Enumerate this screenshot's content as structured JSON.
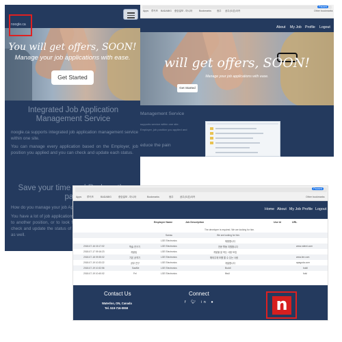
{
  "mobile": {
    "logo_text": "noogle.ca",
    "hero_title": "You will get offers, SOON!",
    "hero_sub": "Manage your job applications with ease.",
    "cta": "Get Started",
    "section1_title": "Integrated Job Application Management Service",
    "section1_p1": "noogle.ca supports integrated job application management service within one site.",
    "section1_p2": "You can manage every application based on the Employer, job position you applied and you can check and update each status.",
    "section2_title": "Save your time and Reduce the pain.",
    "section2_p1": "How do you manage your job Applications?",
    "section2_p2": "You have a lot of job applications to manage when you try to move to another position, or to look for a new job. It is very painful to check and update the status of each application and to follow up, as well."
  },
  "desktop": {
    "browser_profile": "Paused",
    "bookmarks": [
      "Apps",
      "루키즈",
      "BADABIG",
      "중앙일보 - 마니아",
      "Bookmarks",
      "광주",
      "공주(오픈)이카",
      "Other bookmarks"
    ],
    "nav": [
      "About",
      "My Job",
      "Profile",
      "Logout"
    ],
    "hero_title": "will get offers, SOON!",
    "hero_sub": "Manage your job applications with ease.",
    "cta": "Get Started",
    "section1_title": "Management Service",
    "section1_p1": "supports service within one site.",
    "section1_p2": "Employer, job position you applied and",
    "section2_title": "educe the pain"
  },
  "desktop2": {
    "browser_profile": "Paused",
    "bookmarks": [
      "Apps",
      "루키즈",
      "BADABIG",
      "중앙일보 - 마니아",
      "Bookmarks",
      "광주",
      "공주(오픈)이카",
      "Other bookmarks"
    ],
    "nav": [
      "Home",
      "About",
      "My Job",
      "Profile",
      "Logout"
    ],
    "table_headers": [
      "Employer Name",
      "Job Description",
      "Use Id",
      "URL"
    ],
    "table_rows": [
      [
        "",
        "",
        "",
        "The developer is required. We are looking for him.",
        "",
        ""
      ],
      [
        "",
        "",
        "Samsu",
        "We are looking for him.",
        "",
        ""
      ],
      [
        "",
        "",
        "LGE Electronics",
        "채용합니다",
        "",
        ""
      ],
      [
        "2018-07-16 15:17:02",
        "학술 연구기",
        "LGE Electronics",
        "전문 활동 지원합니다",
        "",
        "www.ndemi.com"
      ],
      [
        "2018-07-17 09:16:23",
        "개발팀",
        "LGE Electronics",
        "개발을 잘 하는 사람 모집",
        "",
        ""
      ],
      [
        "2018-07-18 09:35:02",
        "기본 공격기",
        "LGE Electronics",
        "해외주재 모를 할 수 있는 사람",
        "",
        "www.lee.com"
      ],
      [
        "2018-07-19 10:33:22",
        "공부 연구",
        "LGE Electronics",
        "개발합니다",
        "",
        "apagoda.com"
      ],
      [
        "2018-07-19 10:32:56",
        "SaaMe",
        "LGE Electronics",
        "Buddi",
        "",
        "buldi"
      ],
      [
        "2018-07-19 10:40:02",
        "Fel",
        "LGE Electronics",
        "fibull",
        "",
        "fulsl"
      ]
    ],
    "footer_contact": "Contact Us",
    "footer_city": "Waterloo, ON, Canada",
    "footer_tel": "Tel. 519-716-0959",
    "footer_connect": "Connect",
    "footer_social": [
      "f",
      "t",
      "in",
      "gh"
    ],
    "logo": "n"
  }
}
